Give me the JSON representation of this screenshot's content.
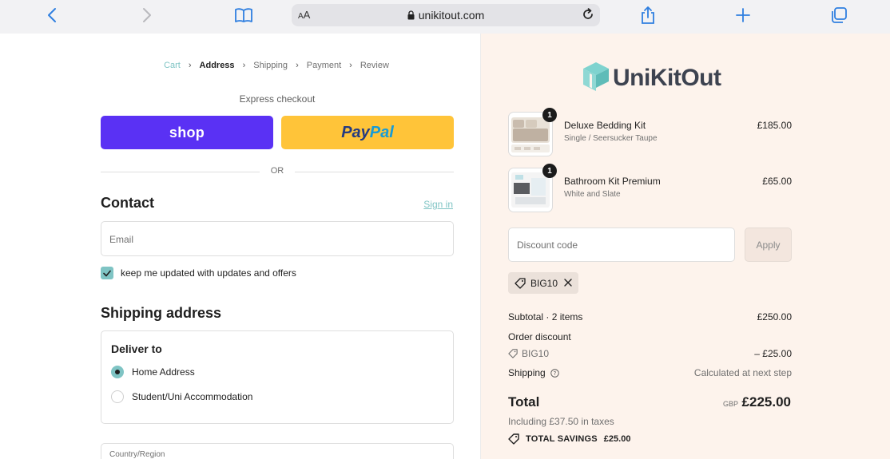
{
  "browser": {
    "url": "unikitout.com",
    "text_size_label": "AA"
  },
  "breadcrumb": [
    "Cart",
    "Address",
    "Shipping",
    "Payment",
    "Review"
  ],
  "express": {
    "title": "Express checkout",
    "shop_label": "shop",
    "paypal_part1": "Pay",
    "paypal_part2": "Pal",
    "or_label": "OR"
  },
  "contact": {
    "heading": "Contact",
    "sign_in": "Sign in",
    "email_placeholder": "Email",
    "newsletter_label": "keep me updated with updates and offers",
    "newsletter_checked": true
  },
  "shipping": {
    "heading": "Shipping address",
    "deliver_to": "Deliver to",
    "options": [
      {
        "label": "Home Address",
        "selected": true
      },
      {
        "label": "Student/Uni Accommodation",
        "selected": false
      }
    ],
    "country_label": "Country/Region"
  },
  "summary": {
    "brand": {
      "name_part1": "Uni",
      "name_part2": "KitOut"
    },
    "items": [
      {
        "name": "Deluxe Bedding Kit",
        "variant": "Single / Seersucker Taupe",
        "price": "£185.00",
        "qty": "1"
      },
      {
        "name": "Bathroom Kit Premium",
        "variant": "White and Slate",
        "price": "£65.00",
        "qty": "1"
      }
    ],
    "discount_placeholder": "Discount code",
    "apply_label": "Apply",
    "applied_code": "BIG10",
    "subtotal_label": "Subtotal · 2 items",
    "subtotal_value": "£250.00",
    "order_discount_label": "Order discount",
    "discount_code": "BIG10",
    "discount_value": "– £25.00",
    "shipping_label": "Shipping",
    "shipping_value": "Calculated at next step",
    "total_label": "Total",
    "currency": "GBP",
    "total_value": "£225.00",
    "taxes_note": "Including £37.50 in taxes",
    "savings_label": "TOTAL SAVINGS",
    "savings_value": "£25.00"
  },
  "colors": {
    "accent": "#7fc4c4",
    "shop": "#5a31f4",
    "paypal": "#ffc439",
    "summary_bg": "#fdf3ec"
  }
}
